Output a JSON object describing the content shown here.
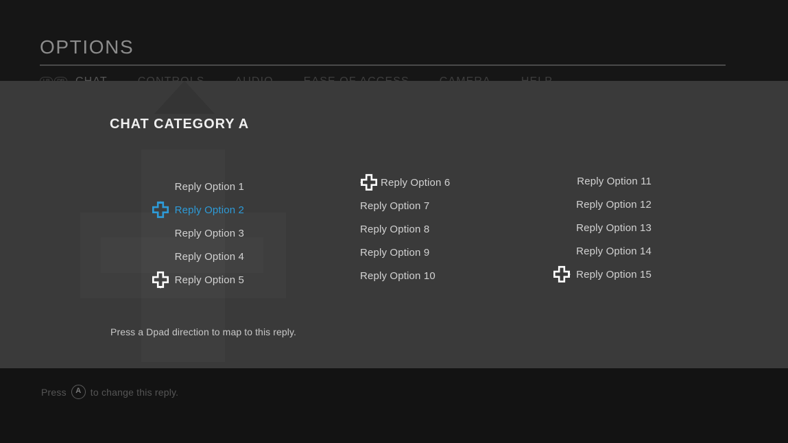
{
  "header": {
    "page_title": "OPTIONS",
    "bumper_left": "LB",
    "bumper_right": "RB",
    "tabs": [
      {
        "label": "CHAT",
        "active": true
      },
      {
        "label": "CONTROLS",
        "active": false
      },
      {
        "label": "AUDIO",
        "active": false
      },
      {
        "label": "EASE OF ACCESS",
        "active": false
      },
      {
        "label": "CAMERA",
        "active": false
      },
      {
        "label": "HELP",
        "active": false
      }
    ]
  },
  "panel": {
    "category_title": "CHAT CATEGORY A",
    "helper_text": "Press a Dpad direction to map to this reply.",
    "columns": [
      {
        "name": "column-1",
        "options": [
          {
            "label": "Reply Option 1",
            "dpad": null,
            "selected": false
          },
          {
            "label": "Reply Option 2",
            "dpad": "up",
            "selected": true
          },
          {
            "label": "Reply Option 3",
            "dpad": null,
            "selected": false
          },
          {
            "label": "Reply Option 4",
            "dpad": null,
            "selected": false
          },
          {
            "label": "Reply Option 5",
            "dpad": "down",
            "selected": false
          }
        ]
      },
      {
        "name": "column-2",
        "options": [
          {
            "label": "Reply Option 6",
            "dpad": "left",
            "selected": false
          },
          {
            "label": "Reply Option 7",
            "dpad": null,
            "selected": false
          },
          {
            "label": "Reply Option 8",
            "dpad": null,
            "selected": false
          },
          {
            "label": "Reply Option 9",
            "dpad": null,
            "selected": false
          },
          {
            "label": "Reply Option 10",
            "dpad": null,
            "selected": false
          }
        ]
      },
      {
        "name": "column-3",
        "options": [
          {
            "label": "Reply Option 11",
            "dpad": null,
            "selected": false
          },
          {
            "label": "Reply Option 12",
            "dpad": null,
            "selected": false
          },
          {
            "label": "Reply Option 13",
            "dpad": null,
            "selected": false
          },
          {
            "label": "Reply Option 14",
            "dpad": null,
            "selected": false
          },
          {
            "label": "Reply Option 15",
            "dpad": "right",
            "selected": false
          }
        ]
      }
    ]
  },
  "footer": {
    "hint_prefix": "Press",
    "button_glyph": "A",
    "hint_suffix": "to change this reply."
  },
  "colors": {
    "accent_blue": "#2e9bd8",
    "panel_bg": "#3a3a3a",
    "header_bg": "#161616",
    "footer_bg": "#131313",
    "text_primary": "#d2d2d2",
    "text_dim": "#555555"
  }
}
